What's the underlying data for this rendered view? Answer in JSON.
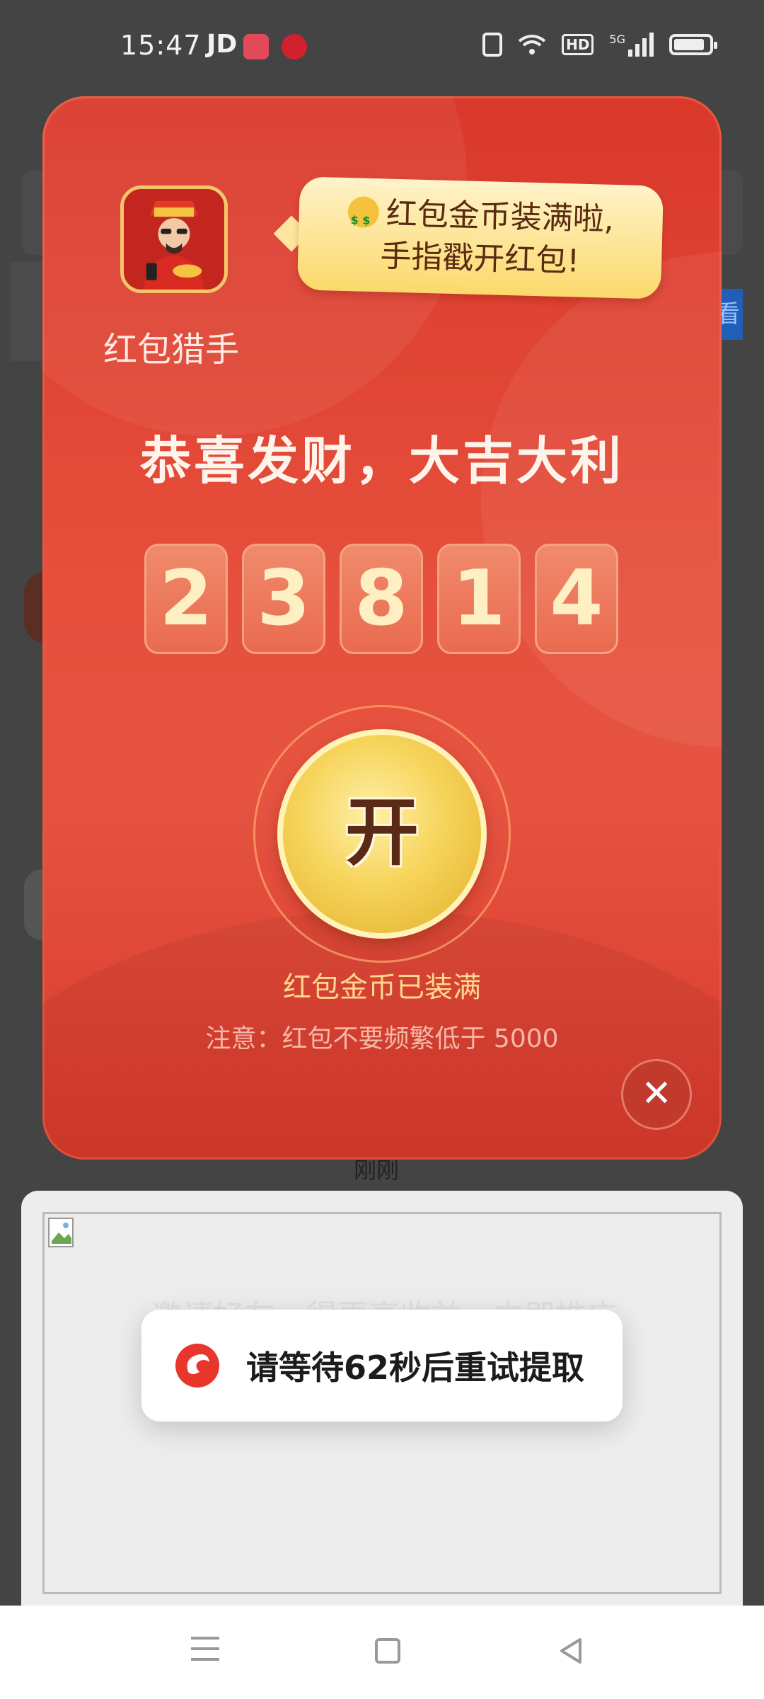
{
  "status_bar": {
    "time": "15:47",
    "carrier": "JD",
    "network": "5G",
    "hd_label": "HD"
  },
  "packet": {
    "app_name": "红包猎手",
    "tip_line1": "红包金币装满啦,",
    "tip_line2": "手指戳开红包!",
    "headline": "恭喜发财，大吉大利",
    "digits": [
      "2",
      "3",
      "8",
      "1",
      "4"
    ],
    "open_label": "开",
    "full_text": "红包金币已装满",
    "note_text": "注意：红包不要频繁低于 5000",
    "close_icon": "close-icon"
  },
  "background": {
    "time_label": "刚刚",
    "side_button": "看"
  },
  "lower_card": {
    "invite_text": "邀请好友，得更高收益，立即推广"
  },
  "toast": {
    "message": "请等待62秒后重试提取"
  },
  "navbar": {
    "menu_icon": "menu-icon",
    "home_icon": "home-icon",
    "back_icon": "back-icon"
  },
  "colors": {
    "packet_red": "#e64f3c",
    "gold": "#f6d45a",
    "tip_bg": "#fbd96b"
  }
}
